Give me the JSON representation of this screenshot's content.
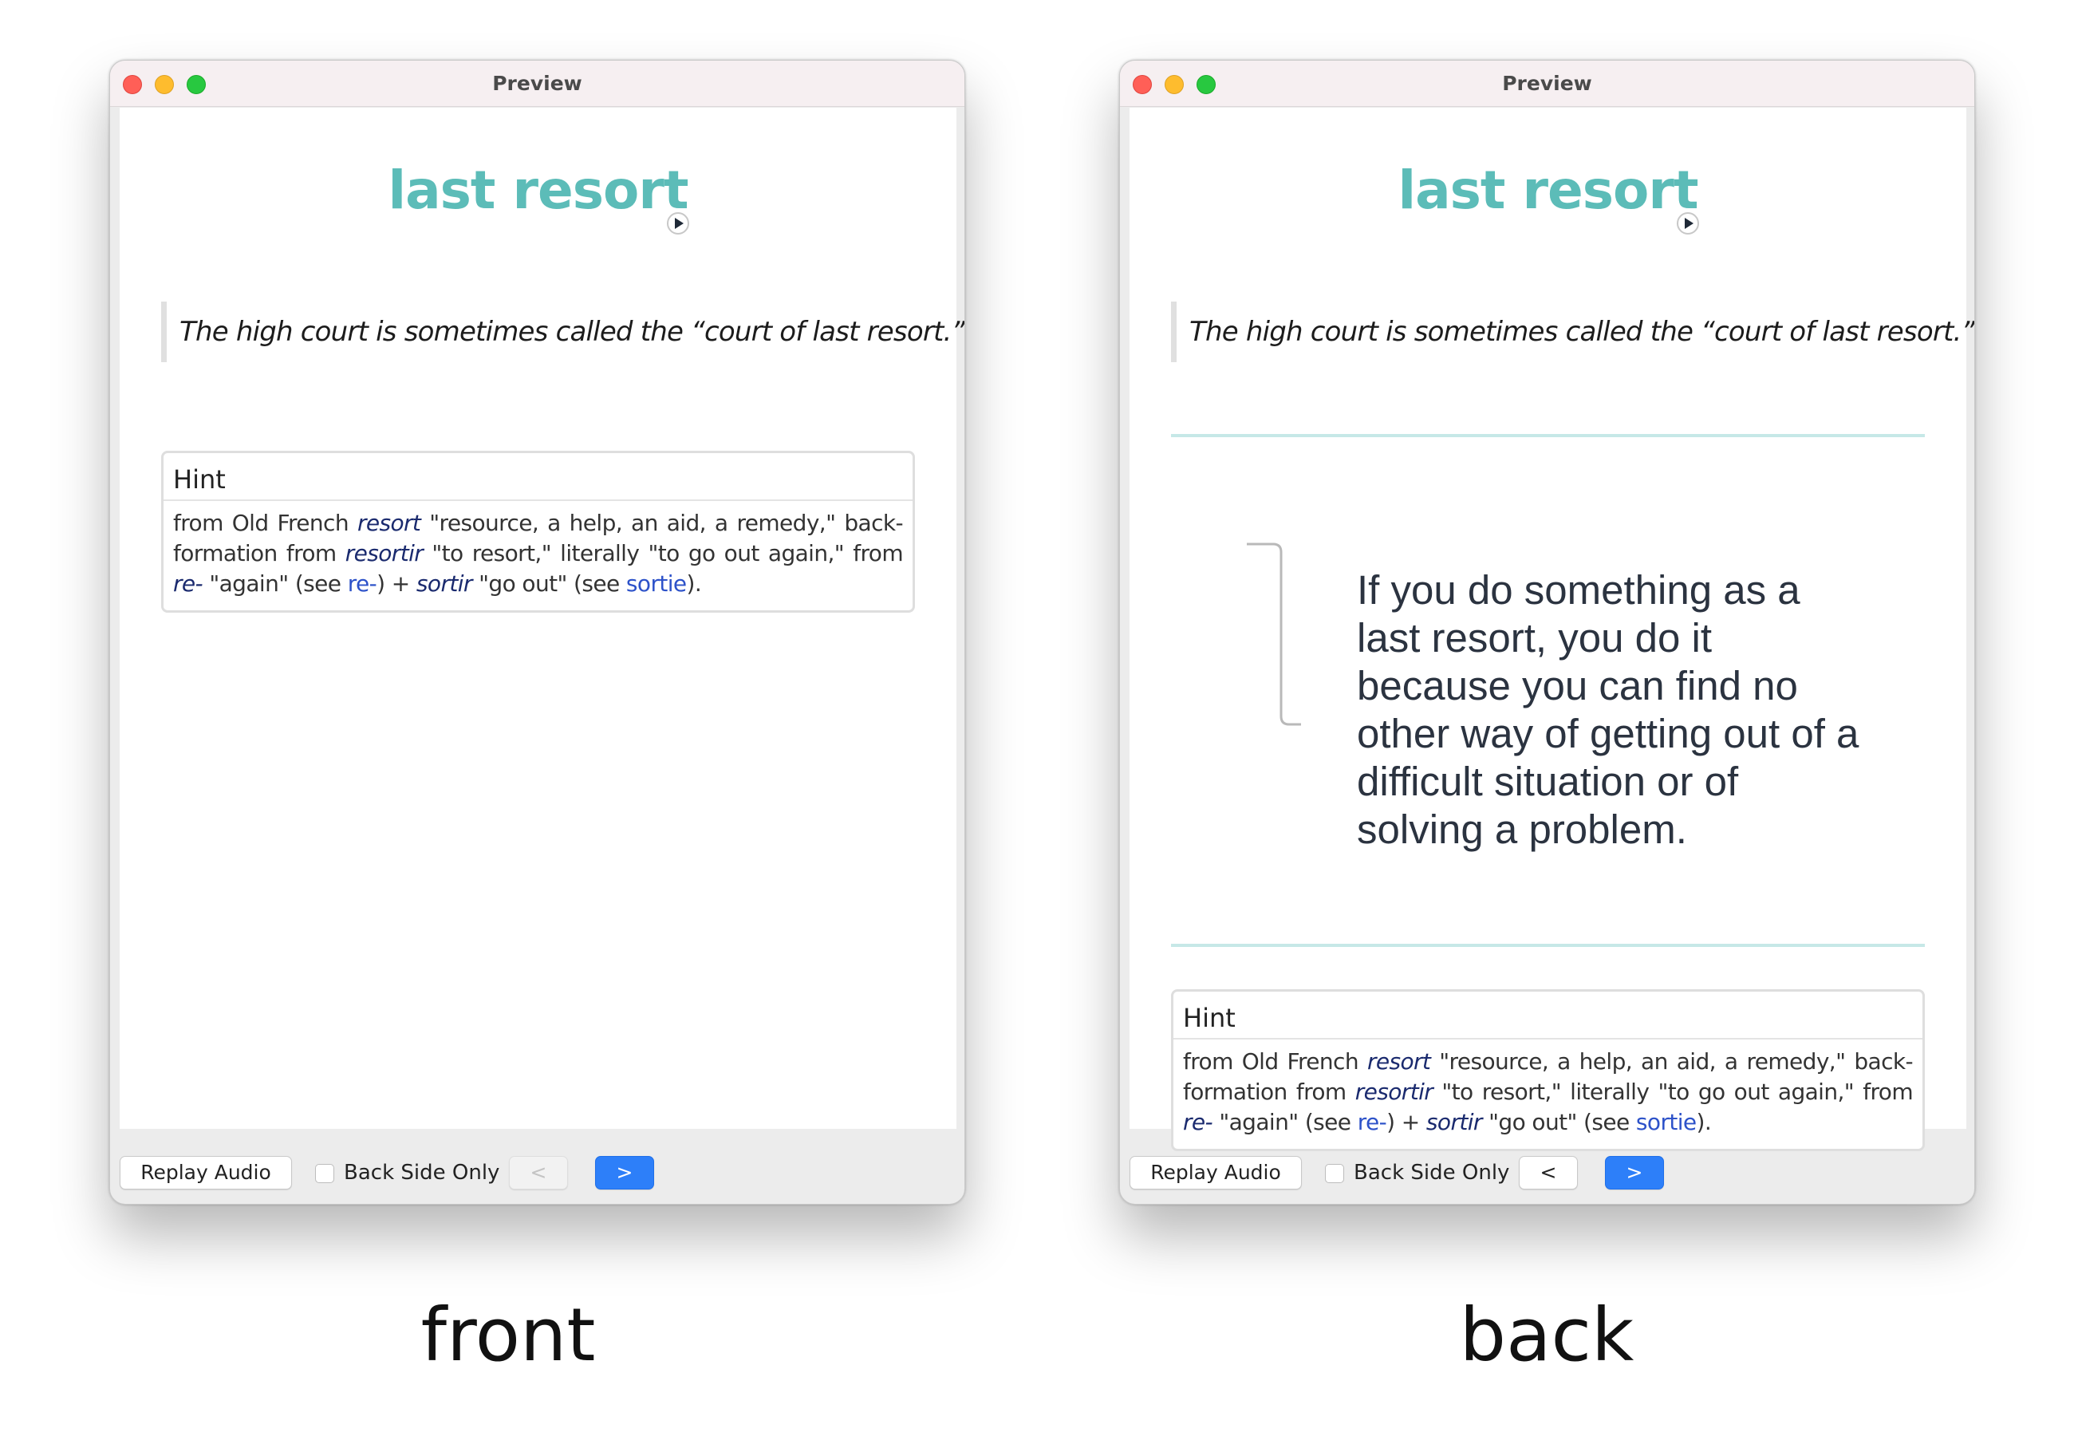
{
  "front": {
    "window_title": "Preview",
    "card": {
      "word": "last resort",
      "example": "The high court is sometimes called the “court of last resort.”",
      "hint": {
        "title": "Hint",
        "p1": "from Old French ",
        "em1": "resort",
        "p2": " \"resource, a help, an aid, a remedy,\" back-formation from ",
        "em2": "resortir",
        "p3": " \"to resort,\" literally \"to go out again,\" from ",
        "em3": "re-",
        "p4": " \"again\" (see ",
        "link1": "re-",
        "p5": ") + ",
        "em4": "sortir",
        "p6": " \"go out\" (see ",
        "link2": "sortie",
        "p7": ")."
      }
    },
    "toolbar": {
      "replay_label": "Replay Audio",
      "back_side_only_label": "Back Side Only",
      "back_side_only_checked": false,
      "prev_label": "<",
      "prev_enabled": false,
      "next_label": ">"
    },
    "caption": "front"
  },
  "back": {
    "window_title": "Preview",
    "card": {
      "word": "last resort",
      "example": "The high court is sometimes called the “court of last resort.”",
      "definition": "If you do something as a last resort, you do it because you can find no other way of getting out of a difficult situation or of solving a problem.",
      "hint": {
        "title": "Hint",
        "p1": "from Old French ",
        "em1": "resort",
        "p2": " \"resource, a help, an aid, a remedy,\" back-formation from ",
        "em2": "resortir",
        "p3": " \"to resort,\" literally \"to go out again,\" from ",
        "em3": "re-",
        "p4": " \"again\" (see ",
        "link1": "re-",
        "p5": ") + ",
        "em4": "sortir",
        "p6": " \"go out\" (see ",
        "link2": "sortie",
        "p7": ")."
      }
    },
    "toolbar": {
      "replay_label": "Replay Audio",
      "back_side_only_label": "Back Side Only",
      "back_side_only_checked": false,
      "prev_label": "<",
      "prev_enabled": true,
      "next_label": ">"
    },
    "caption": "back"
  },
  "colors": {
    "word": "#5cbcb8",
    "divider": "#c6e8e7",
    "next_button": "#2d7ff9",
    "link": "#2d52c9",
    "hint_italic": "#1a2a6e"
  },
  "icons": [
    "play-icon",
    "close-light",
    "minimize-light",
    "zoom-light",
    "bracket-icon"
  ]
}
